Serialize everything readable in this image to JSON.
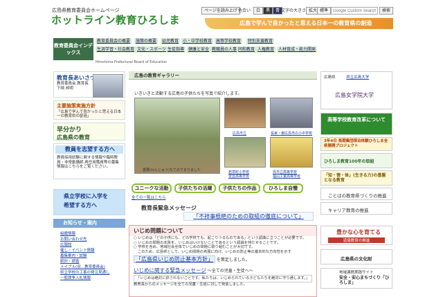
{
  "header": {
    "subtitle": "広島県教育委員会ホームページ",
    "title": "ホットライン教育ひろしま",
    "banner": "広島で学んで良かったと思える日本一の教育県の創造"
  },
  "toolbar": {
    "page_reading": "ページを読み上げ",
    "color_label": "色合い",
    "color_white": "白",
    "color_black": "黒",
    "color_blue": "青",
    "font_label": "文字の大きさ",
    "enlarge": "拡大",
    "standard": "標準",
    "search_placeholder": "Google Custom Search",
    "search_button": "検索"
  },
  "nav": {
    "box_title": "教育委員会インデックス",
    "items": [
      "教育委員会の概要",
      "施策の概要",
      "幼児教育",
      "小・中学校教育",
      "高等学校教育",
      "特別支援教育",
      "生涯学習・社会教育",
      "文化・スポーツ",
      "生徒指導",
      "健康と安全",
      "教職員の人事",
      "同和教育",
      "人権教育",
      "人材育成・能力開発"
    ],
    "subtitle": "Hiroshima Prefectural Board of Education"
  },
  "left": {
    "greet_title": "教育長あいさつ",
    "greet_name1": "教育委員会 教育長",
    "greet_name2": "下崎 邦明",
    "policy_title": "主要施策実施方針",
    "policy_text": "「広島で学んで良かったと思える日本一の教育県の創造」",
    "hayawakari1": "早分かり",
    "hayawakari2": "広島県の教育",
    "teacher_title": "教員を志望する方へ",
    "teacher_text": "教員採用試験に関する情報や臨時教員・非常勤講師,再任用職員等の募集情報はこちらをご覧ください。",
    "school_title1": "県立学校に入学を",
    "school_title2": "希望する方へ",
    "info_head": "お知らせ・案内",
    "info_links": [
      "組織情報",
      "お問い合わせ先",
      "広報誌",
      "催し・イベント情報",
      "募集案内・試験",
      "統計・調査",
      "メイブル(旧…教育委員会)",
      "県立学校の工事の発注見通し",
      "一般競争入札情報"
    ]
  },
  "main": {
    "gallery_head": "広島の教育ギャラリー",
    "gallery_intro": "いきいきと活動する広島の子供たちを写真で紹介します。",
    "captions": [
      "広島市立",
      "長束・東広島市の小中学校",
      "若草町小学校",
      "呉市立高等学校",
      "安芸高等学校",
      "福山工業高等学校"
    ],
    "big_caption": "重要(わんじゅう)ちてのでまりました",
    "tags": [
      "ユニークな活動",
      "子供たちの活躍",
      "子供たちの作品",
      "ひろしま自慢"
    ],
    "list_link": "全ての一覧はこちら",
    "speech_head": "教育長緊急メッセージ",
    "speech_link": "「不祥事根絶のための取組の徹底について」",
    "bully_head": "いじめ問題について",
    "bully_lines": [
      "○ いじめは「どの子供にも、どの学校でも、起こりうるものである」という認識に立つことが必要です。",
      "○ いじめの問題の本質を、いじめはいけないことであるという認識を持たせることです。",
      "○ 学校を含め、地域社会全体でいじめの問題に取り組むことが大切です。",
      "このため、広島県として、いじめ問題の克服に向け、いじめの防止等の基本的な方向性を示す"
    ],
    "bully_link": "「広島県いじめ防止基本方針」",
    "bully_tail": "を策定しました。",
    "urgent_link": "いじめに関する緊急メッセージ",
    "urgent_tail": "～全ての児童・生徒へ～",
    "urgent_line1": "「いじめは絶対に許されないことです。私たちは、いじめられている子どもたちを絶対に守り通します。」",
    "urgent_line2": "教育長からのメッセージを全ての児童・生徒に対して発信しました。"
  },
  "right": {
    "univ_label": "広島県",
    "univ_link": "県立広島大学",
    "univ_name": "広島女学院大学",
    "koko": "高等学校教育改革について",
    "long_project": "3年4日 長期集団宿泊体験ひろしま全県展開プロジェクト",
    "education100": "ひろしま教育100年の取組",
    "chitoku": "「知・徳・体」(生きる力)の基盤となる教育",
    "reform": "ことばの教育県づくりの推進",
    "career": "キャリア教育の推進",
    "kokoro": "豊かな心を育てる",
    "kokoro_sub": "道徳教育の推進",
    "culture": "広島県の文化財",
    "safety1": "地域連携実践サイト",
    "safety2": "安全・安心まちづくり「ひろしま」"
  },
  "colors": {
    "green": "#2e8b2e",
    "orange": "#e8902a",
    "navy": "#1d3b8f"
  }
}
